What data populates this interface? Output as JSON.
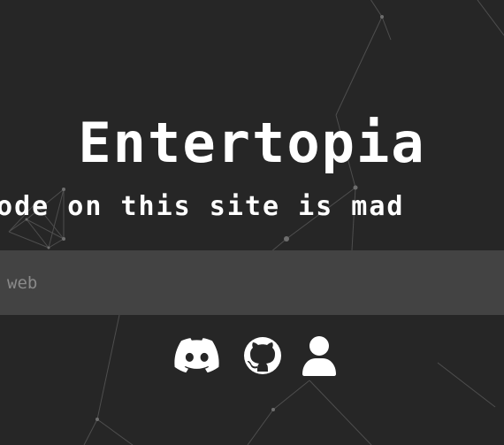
{
  "app": {
    "title": "Entertopia",
    "tagline": "code on this site is mad"
  },
  "search": {
    "value": "",
    "placeholder": "web"
  },
  "socials": [
    {
      "icon": "discord-icon"
    },
    {
      "icon": "github-icon"
    },
    {
      "icon": "user-icon"
    }
  ],
  "colors": {
    "background": "#262626",
    "search_bar": "#434343",
    "text": "#ffffff",
    "placeholder": "#8a8a8a",
    "network": "#4e4e4e"
  }
}
